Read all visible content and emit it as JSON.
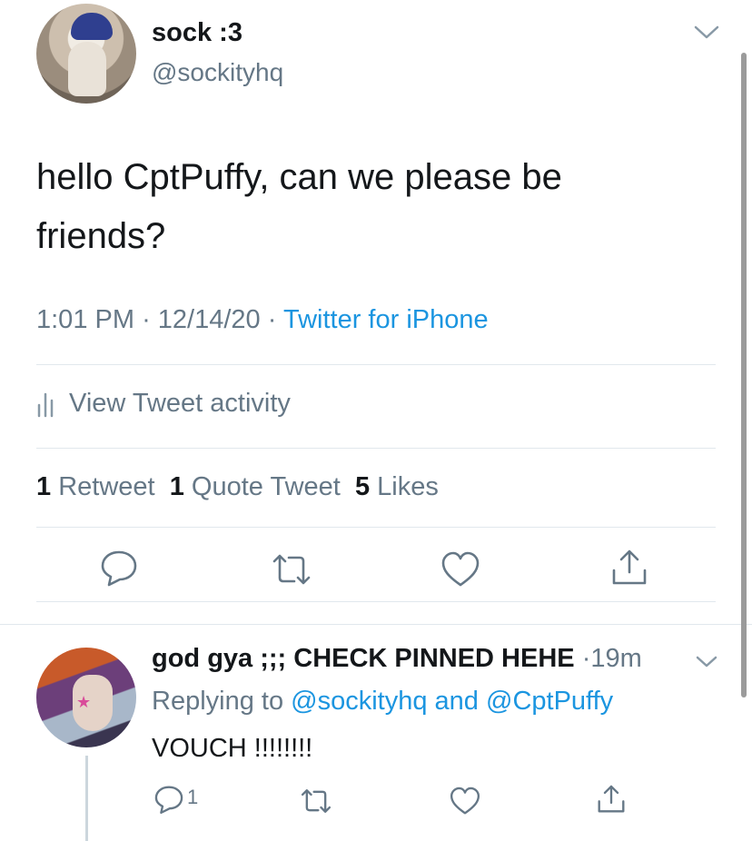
{
  "tweet": {
    "display_name": "sock :3",
    "handle": "@sockityhq",
    "text_line1": "hello CptPuffy, can we please be",
    "text_line2": "friends?",
    "time": "1:01 PM",
    "date": "12/14/20",
    "separator": "·",
    "source": "Twitter for iPhone",
    "activity_label": "View Tweet activity",
    "stats": {
      "retweets_count": "1",
      "retweets_label": "Retweet",
      "quote_count": "1",
      "quote_label": "Quote Tweet",
      "likes_count": "5",
      "likes_label": "Likes"
    }
  },
  "reply": {
    "display_name": "god gya ;;; CHECK PINNED HEHE",
    "separator": "·",
    "time": "19m",
    "replying_prefix": "Replying to",
    "mention_1": "@sockityhq",
    "conjunction": "and",
    "mention_2": "@CptPuffy",
    "text": "VOUCH !!!!!!!!",
    "reply_count": "1"
  },
  "colors": {
    "link": "#1b95e0",
    "secondary_text": "#657786",
    "primary_text": "#14171a",
    "divider": "#e1e8ed"
  },
  "icons": {
    "menu": "chevron-down-icon",
    "activity": "bar-chart-icon",
    "reply": "speech-bubble-icon",
    "retweet": "retweet-icon",
    "like": "heart-icon",
    "share": "share-icon"
  }
}
